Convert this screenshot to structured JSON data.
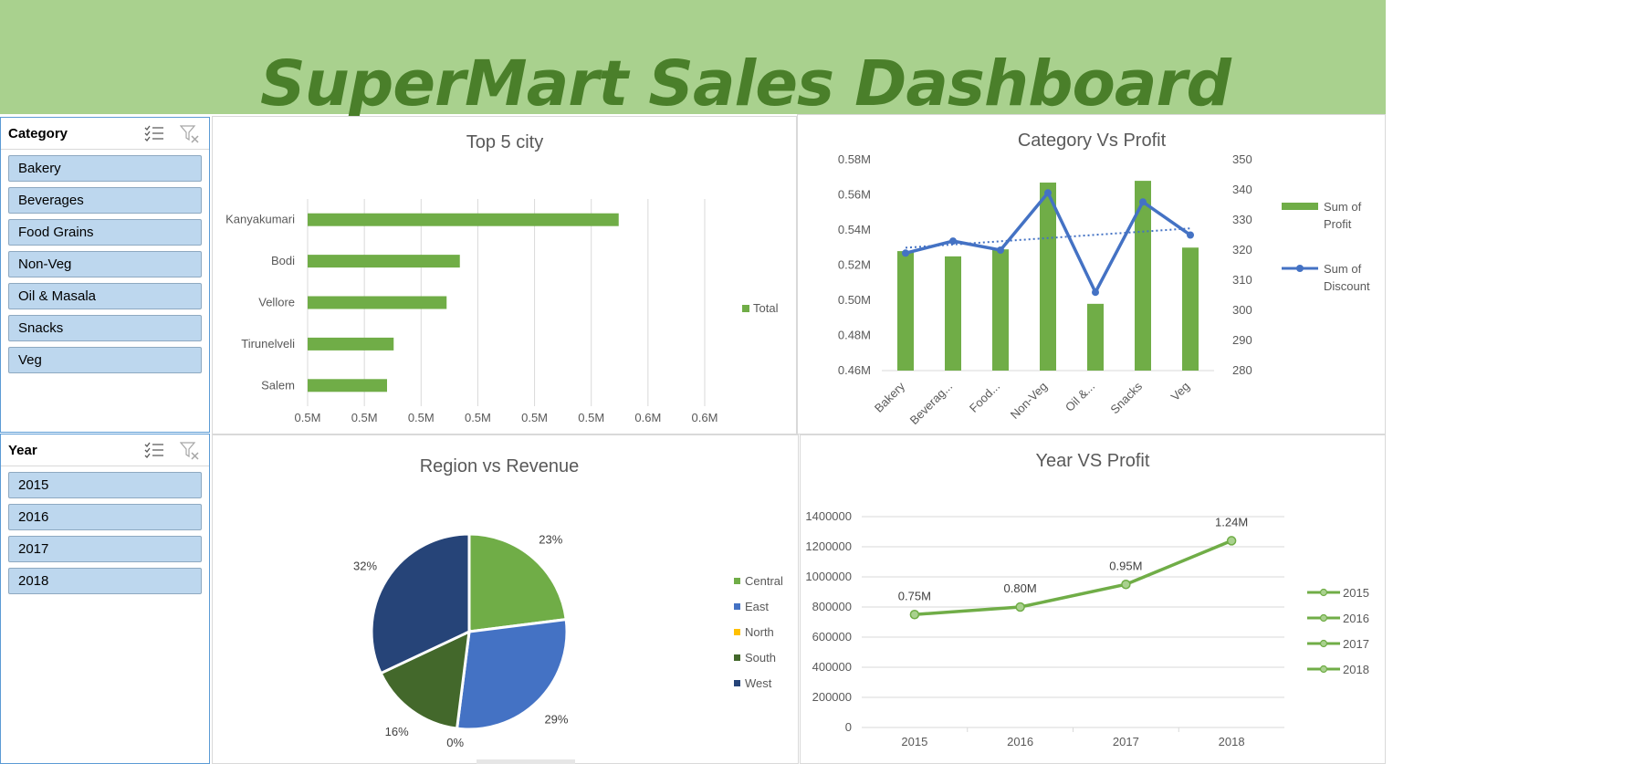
{
  "dashboard": {
    "title": "SuperMart Sales Dashboard"
  },
  "slicers": {
    "category": {
      "title": "Category",
      "items": [
        "Bakery",
        "Beverages",
        "Food Grains",
        "Non-Veg",
        "Oil & Masala",
        "Snacks",
        "Veg"
      ]
    },
    "year": {
      "title": "Year",
      "items": [
        "2015",
        "2016",
        "2017",
        "2018"
      ]
    }
  },
  "icons": {
    "multi_select": "multi-select-icon",
    "clear_filter": "clear-filter-icon"
  },
  "colors": {
    "green": "#70ad47",
    "blue": "#4472c4",
    "yellow": "#ffc000",
    "dark_green": "#43682b",
    "navy": "#264478",
    "banner": "#a9d18e",
    "title_green": "#4a7f2a"
  },
  "chart_data": [
    {
      "type": "bar",
      "orientation": "horizontal",
      "title": "Top 5 city",
      "categories": [
        "Kanyakumari",
        "Bodi",
        "Vellore",
        "Tirunelveli",
        "Salem"
      ],
      "series": [
        {
          "name": "Total",
          "values": [
            0.547,
            0.523,
            0.521,
            0.513,
            0.512
          ]
        }
      ],
      "xlim": [
        0.5,
        0.56
      ],
      "x_ticks": [
        "0.5M",
        "0.5M",
        "0.5M",
        "0.5M",
        "0.5M",
        "0.5M",
        "0.6M",
        "0.6M"
      ],
      "grid": true,
      "legend": "right"
    },
    {
      "type": "bar",
      "title": "Category Vs Profit",
      "categories": [
        "Bakery",
        "Beverag...",
        "Food...",
        "Non-Veg",
        "Oil &...",
        "Snacks",
        "Veg"
      ],
      "series": [
        {
          "name": "Sum of Profit",
          "type": "bar",
          "axis": "left",
          "values": [
            0.528,
            0.525,
            0.529,
            0.567,
            0.498,
            0.568,
            0.53
          ]
        },
        {
          "name": "Sum of Discount",
          "type": "line",
          "axis": "right",
          "values": [
            319,
            323,
            320,
            339,
            306,
            336,
            325
          ]
        }
      ],
      "ylim_left": [
        0.46,
        0.58
      ],
      "y_ticks_left": [
        "0.58M",
        "0.56M",
        "0.54M",
        "0.52M",
        "0.50M",
        "0.48M",
        "0.46M"
      ],
      "ylim_right": [
        280,
        350
      ],
      "y_ticks_right": [
        "350",
        "340",
        "330",
        "320",
        "310",
        "300",
        "290",
        "280"
      ],
      "trendline": true,
      "grid": false,
      "legend": "right"
    },
    {
      "type": "pie",
      "title": "Region vs Revenue",
      "categories": [
        "Central",
        "East",
        "North",
        "South",
        "West"
      ],
      "values": [
        23,
        29,
        0,
        16,
        32
      ],
      "labels": [
        "23%",
        "29%",
        "0%",
        "16%",
        "32%"
      ],
      "colors": [
        "#70ad47",
        "#4472c4",
        "#ffc000",
        "#43682b",
        "#264478"
      ],
      "legend": "right"
    },
    {
      "type": "line",
      "title": "Year VS Profit",
      "categories": [
        "2015",
        "2016",
        "2017",
        "2018"
      ],
      "values": [
        750000,
        800000,
        950000,
        1240000
      ],
      "data_labels": [
        "0.75M",
        "0.80M",
        "0.95M",
        "1.24M"
      ],
      "ylim": [
        0,
        1400000
      ],
      "y_ticks": [
        "1400000",
        "1200000",
        "1000000",
        "800000",
        "600000",
        "400000",
        "200000",
        "0"
      ],
      "legend_entries": [
        "2015",
        "2016",
        "2017",
        "2018"
      ],
      "grid": true,
      "legend": "right"
    }
  ]
}
